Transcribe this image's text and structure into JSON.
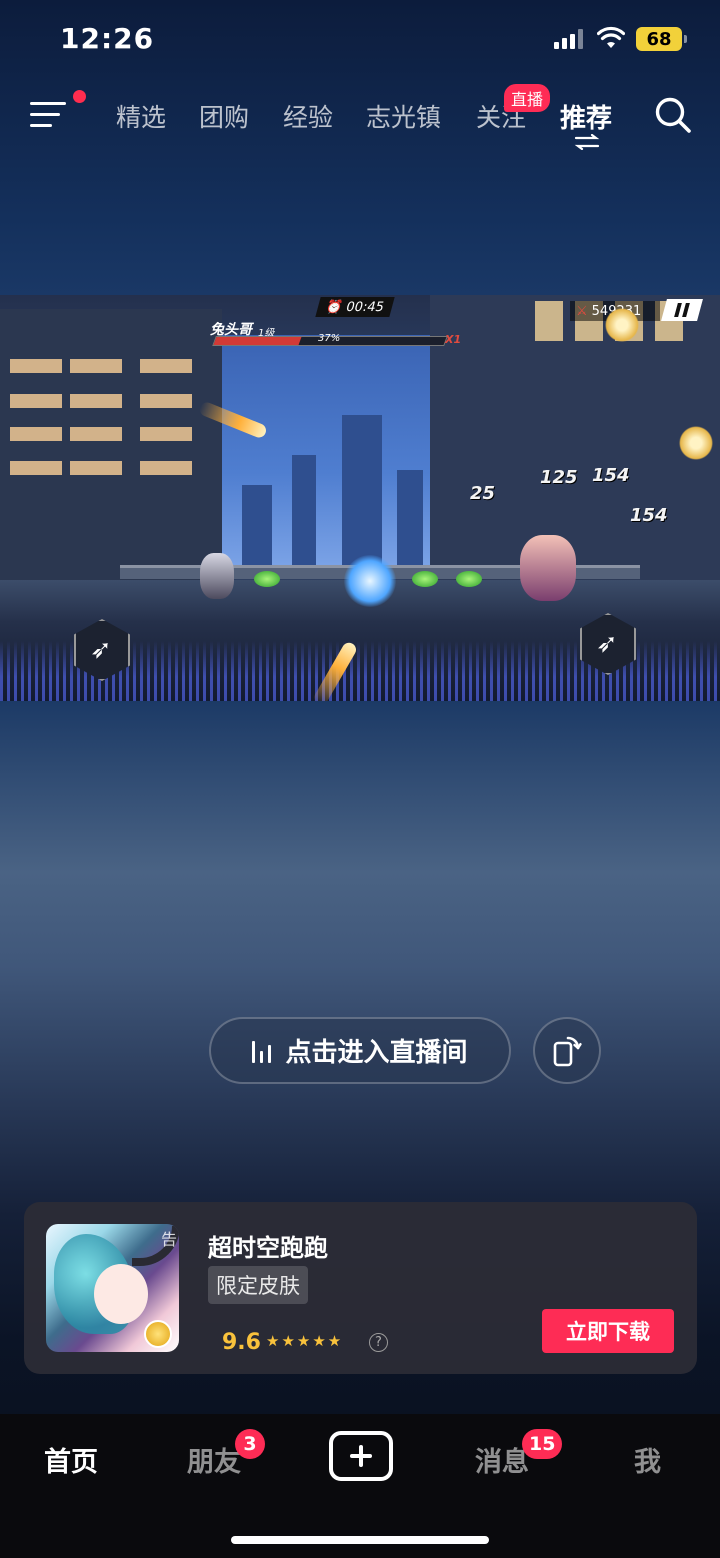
{
  "status_bar": {
    "time": "12:26",
    "battery": "68"
  },
  "top_nav": {
    "tabs": [
      {
        "label": "精选"
      },
      {
        "label": "团购"
      },
      {
        "label": "经验"
      },
      {
        "label": "志光镇"
      },
      {
        "label": "关注"
      },
      {
        "label": "推荐"
      }
    ],
    "live_badge": "直播",
    "active_tab": "推荐"
  },
  "game_video": {
    "timer": "00:45",
    "player_name": "兔头哥",
    "player_level": "1级",
    "hp_percent_label": "37%",
    "hp_fraction": 0.37,
    "multiplier": "X1",
    "score": "549231",
    "damage_numbers": [
      "25",
      "125",
      "154",
      "154"
    ]
  },
  "live_controls": {
    "enter_live_label": "点击进入直播间"
  },
  "ad": {
    "title": "超时空跑跑",
    "tag": "限定皮肤",
    "rating": "9.6",
    "stars": "★★★★★",
    "help": "?",
    "icon_corner_text": "告",
    "download_label": "立即下载"
  },
  "bottom_tabs": {
    "home": "首页",
    "friends": "朋友",
    "friends_badge": "3",
    "messages": "消息",
    "messages_badge": "15",
    "me": "我"
  },
  "colors": {
    "accent": "#fe2c55",
    "rating": "#f9c23c",
    "battery": "#f2d13a"
  }
}
